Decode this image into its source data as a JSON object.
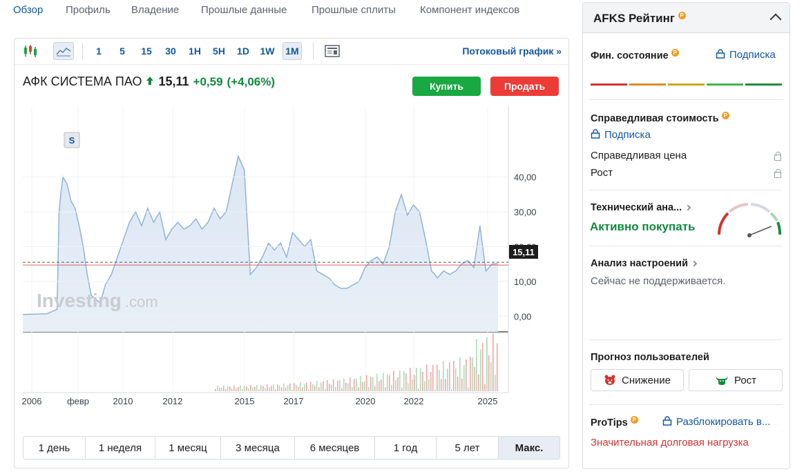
{
  "nav": [
    {
      "label": "Обзор",
      "active": true
    },
    {
      "label": "Профиль",
      "active": false
    },
    {
      "label": "Владение",
      "active": false
    },
    {
      "label": "Прошлые данные",
      "active": false
    },
    {
      "label": "Прошлые сплиты",
      "active": false
    },
    {
      "label": "Компонент индексов",
      "active": false
    }
  ],
  "toolbar": {
    "intervals": [
      "1",
      "5",
      "15",
      "30",
      "1H",
      "5H",
      "1D",
      "1W",
      "1M"
    ],
    "active_interval": "1M",
    "stream_label": "Потоковый график »"
  },
  "stock": {
    "name": "АФК СИСТЕМА ПАО",
    "price": "15,11",
    "change": "+0,59",
    "change_pct": "(+4,06%)",
    "buy_label": "Купить",
    "sell_label": "Продать",
    "watermark_main": "Investing",
    "watermark_suffix": ".com",
    "split_marker": "S",
    "price_tag": "15,11"
  },
  "chart_data": {
    "type": "area",
    "yticks": [
      "0,00",
      "10,00",
      "20,00",
      "30,00",
      "40,00"
    ],
    "ylim": [
      -4.5,
      52
    ],
    "xticks": [
      "2006",
      "февр",
      "2010",
      "2012",
      "2015",
      "2017",
      "2020",
      "2022",
      "2025"
    ],
    "last_price": 15.11,
    "x": [
      "2005-07",
      "2006-01",
      "2006-07",
      "2006-12",
      "2007-01",
      "2007-02",
      "2007-03",
      "2007-05",
      "2007-07",
      "2007-09",
      "2007-11",
      "2008-01",
      "2008-03",
      "2008-05",
      "2008-07",
      "2008-09",
      "2008-10",
      "2008-11",
      "2008-12",
      "2009-03",
      "2009-06",
      "2009-09",
      "2009-12",
      "2010-03",
      "2010-06",
      "2010-09",
      "2010-12",
      "2011-03",
      "2011-06",
      "2011-09",
      "2011-12",
      "2012-03",
      "2012-06",
      "2012-09",
      "2012-12",
      "2013-03",
      "2013-06",
      "2013-09",
      "2013-12",
      "2014-03",
      "2014-06",
      "2014-09",
      "2014-12",
      "2015-03",
      "2015-06",
      "2015-09",
      "2015-12",
      "2016-03",
      "2016-06",
      "2016-09",
      "2016-12",
      "2017-03",
      "2017-06",
      "2017-09",
      "2017-12",
      "2018-03",
      "2018-06",
      "2018-09",
      "2018-12",
      "2019-03",
      "2019-06",
      "2019-09",
      "2019-12",
      "2020-03",
      "2020-06",
      "2020-09",
      "2020-12",
      "2021-03",
      "2021-06",
      "2021-09",
      "2021-12",
      "2022-03",
      "2022-06",
      "2022-09",
      "2022-12",
      "2023-03",
      "2023-06",
      "2023-09",
      "2023-12",
      "2024-03",
      "2024-06",
      "2024-09",
      "2024-12",
      "2025-03"
    ],
    "y": [
      0.5,
      0.6,
      0.7,
      2,
      30,
      36,
      40,
      38,
      33,
      31,
      26,
      20,
      12,
      6,
      5,
      4,
      5,
      7,
      9,
      12,
      17,
      22,
      27,
      30,
      26,
      31,
      27,
      30,
      22,
      25,
      27,
      25,
      26,
      28,
      25,
      27,
      31,
      28,
      30,
      38,
      46,
      42,
      12,
      14,
      17,
      21,
      19,
      21,
      17,
      24,
      22,
      20,
      22,
      13,
      12,
      11,
      9,
      8,
      8,
      9,
      10,
      14,
      16,
      17,
      15,
      20,
      30,
      35,
      29,
      32,
      30,
      22,
      13,
      11,
      13,
      12,
      13,
      15,
      16,
      14,
      26,
      13,
      15,
      15.11
    ],
    "volume_panel": true
  },
  "ranges": [
    "1 день",
    "1 неделя",
    "1 месяц",
    "3 месяца",
    "6 месяцев",
    "1 год",
    "5 лет",
    "Макс."
  ],
  "active_range": "Макс.",
  "sidebar": {
    "title": "AFKS Рейтинг",
    "pro_badge": "P",
    "fin_title": "Фин. состояние",
    "fin_sub": "Подписка",
    "fin_colors": [
      "#d5312c",
      "#e08a1e",
      "#c9a71a",
      "#3db84a",
      "#1c8a3e"
    ],
    "fair_title": "Справедливая стоимость",
    "fair_sub": "Подписка",
    "fair_price": "Справедливая цена",
    "growth": "Рост",
    "tech_title": "Технический ана...",
    "tech_value": "Активно покупать",
    "sentiment_title": "Анализ настроений",
    "sentiment_text": "Сейчас не поддерживается.",
    "forecast_title": "Прогноз пользователей",
    "bear_label": "Снижение",
    "bull_label": "Рост",
    "protips_title": "ProTips",
    "protips_unlock": "Разблокировать в...",
    "protips_tip": "Значительная долговая нагрузка"
  }
}
